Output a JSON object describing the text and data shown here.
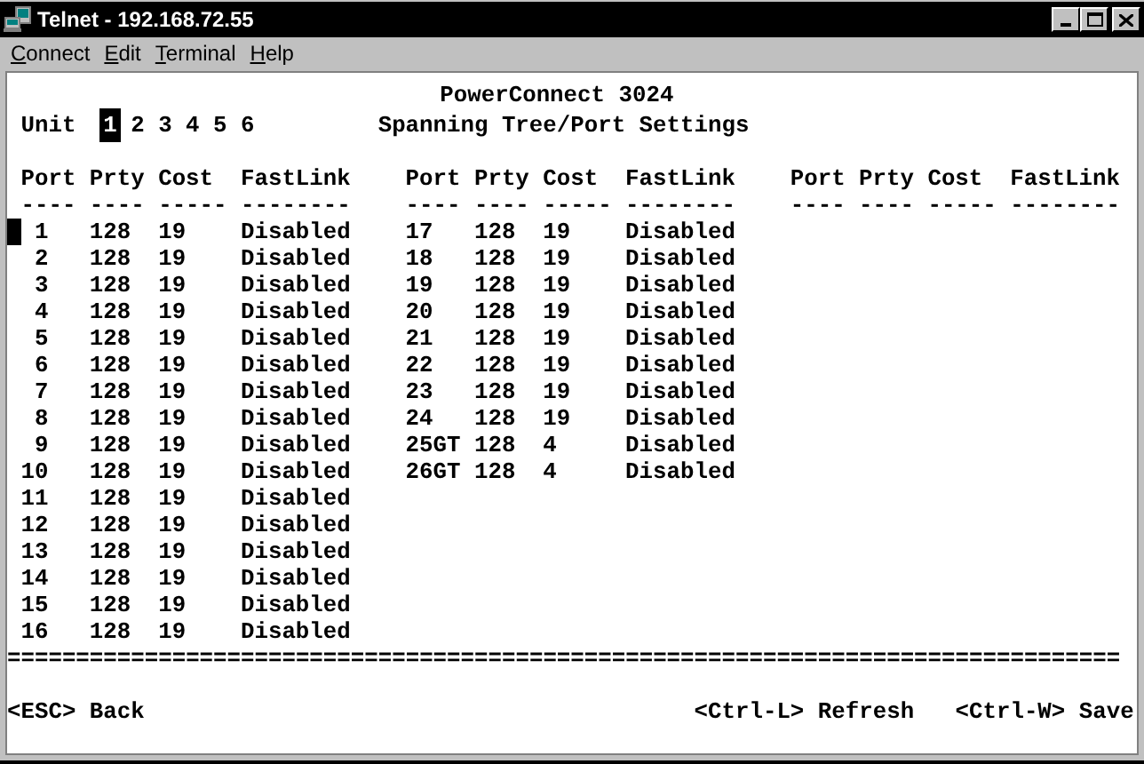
{
  "window": {
    "title": "Telnet - 192.168.72.55"
  },
  "menu": [
    {
      "label": "Connect"
    },
    {
      "label": "Edit"
    },
    {
      "label": "Terminal"
    },
    {
      "label": "Help"
    }
  ],
  "terminal": {
    "product": "PowerConnect 3024",
    "unit_label": "Unit",
    "units": [
      {
        "label": "1",
        "selected": true
      },
      {
        "label": "2",
        "selected": false
      },
      {
        "label": "3",
        "selected": false
      },
      {
        "label": "4",
        "selected": false
      },
      {
        "label": "5",
        "selected": false
      },
      {
        "label": "6",
        "selected": false
      }
    ],
    "screen_title": "Spanning Tree/Port Settings",
    "port_groups": [
      {
        "columns": [
          {
            "label": "Port",
            "underline": "----"
          },
          {
            "label": "Prty",
            "underline": "----"
          },
          {
            "label": "Cost",
            "underline": "-----"
          },
          {
            "label": "FastLink",
            "underline": "--------"
          }
        ],
        "rows": [
          {
            "port": "1",
            "prty": "128",
            "cost": "19",
            "fastlink": "Disabled",
            "cursor": true
          },
          {
            "port": "2",
            "prty": "128",
            "cost": "19",
            "fastlink": "Disabled",
            "cursor": false
          },
          {
            "port": "3",
            "prty": "128",
            "cost": "19",
            "fastlink": "Disabled",
            "cursor": false
          },
          {
            "port": "4",
            "prty": "128",
            "cost": "19",
            "fastlink": "Disabled",
            "cursor": false
          },
          {
            "port": "5",
            "prty": "128",
            "cost": "19",
            "fastlink": "Disabled",
            "cursor": false
          },
          {
            "port": "6",
            "prty": "128",
            "cost": "19",
            "fastlink": "Disabled",
            "cursor": false
          },
          {
            "port": "7",
            "prty": "128",
            "cost": "19",
            "fastlink": "Disabled",
            "cursor": false
          },
          {
            "port": "8",
            "prty": "128",
            "cost": "19",
            "fastlink": "Disabled",
            "cursor": false
          },
          {
            "port": "9",
            "prty": "128",
            "cost": "19",
            "fastlink": "Disabled",
            "cursor": false
          },
          {
            "port": "10",
            "prty": "128",
            "cost": "19",
            "fastlink": "Disabled",
            "cursor": false
          },
          {
            "port": "11",
            "prty": "128",
            "cost": "19",
            "fastlink": "Disabled",
            "cursor": false
          },
          {
            "port": "12",
            "prty": "128",
            "cost": "19",
            "fastlink": "Disabled",
            "cursor": false
          },
          {
            "port": "13",
            "prty": "128",
            "cost": "19",
            "fastlink": "Disabled",
            "cursor": false
          },
          {
            "port": "14",
            "prty": "128",
            "cost": "19",
            "fastlink": "Disabled",
            "cursor": false
          },
          {
            "port": "15",
            "prty": "128",
            "cost": "19",
            "fastlink": "Disabled",
            "cursor": false
          },
          {
            "port": "16",
            "prty": "128",
            "cost": "19",
            "fastlink": "Disabled",
            "cursor": false
          }
        ]
      },
      {
        "columns": [
          {
            "label": "Port",
            "underline": "----"
          },
          {
            "label": "Prty",
            "underline": "----"
          },
          {
            "label": "Cost",
            "underline": "-----"
          },
          {
            "label": "FastLink",
            "underline": "--------"
          }
        ],
        "rows": [
          {
            "port": "17",
            "prty": "128",
            "cost": "19",
            "fastlink": "Disabled",
            "cursor": false
          },
          {
            "port": "18",
            "prty": "128",
            "cost": "19",
            "fastlink": "Disabled",
            "cursor": false
          },
          {
            "port": "19",
            "prty": "128",
            "cost": "19",
            "fastlink": "Disabled",
            "cursor": false
          },
          {
            "port": "20",
            "prty": "128",
            "cost": "19",
            "fastlink": "Disabled",
            "cursor": false
          },
          {
            "port": "21",
            "prty": "128",
            "cost": "19",
            "fastlink": "Disabled",
            "cursor": false
          },
          {
            "port": "22",
            "prty": "128",
            "cost": "19",
            "fastlink": "Disabled",
            "cursor": false
          },
          {
            "port": "23",
            "prty": "128",
            "cost": "19",
            "fastlink": "Disabled",
            "cursor": false
          },
          {
            "port": "24",
            "prty": "128",
            "cost": "19",
            "fastlink": "Disabled",
            "cursor": false
          },
          {
            "port": "25GT",
            "prty": "128",
            "cost": "4",
            "fastlink": "Disabled",
            "cursor": false
          },
          {
            "port": "26GT",
            "prty": "128",
            "cost": "4",
            "fastlink": "Disabled",
            "cursor": false
          }
        ]
      },
      {
        "columns": [
          {
            "label": "Port",
            "underline": "----"
          },
          {
            "label": "Prty",
            "underline": "----"
          },
          {
            "label": "Cost",
            "underline": "-----"
          },
          {
            "label": "FastLink",
            "underline": "--------"
          }
        ]
      }
    ],
    "separator": "=================================================================================",
    "footer": [
      "<ESC> Back",
      "<Ctrl-L> Refresh",
      "<Ctrl-W> Save"
    ]
  }
}
